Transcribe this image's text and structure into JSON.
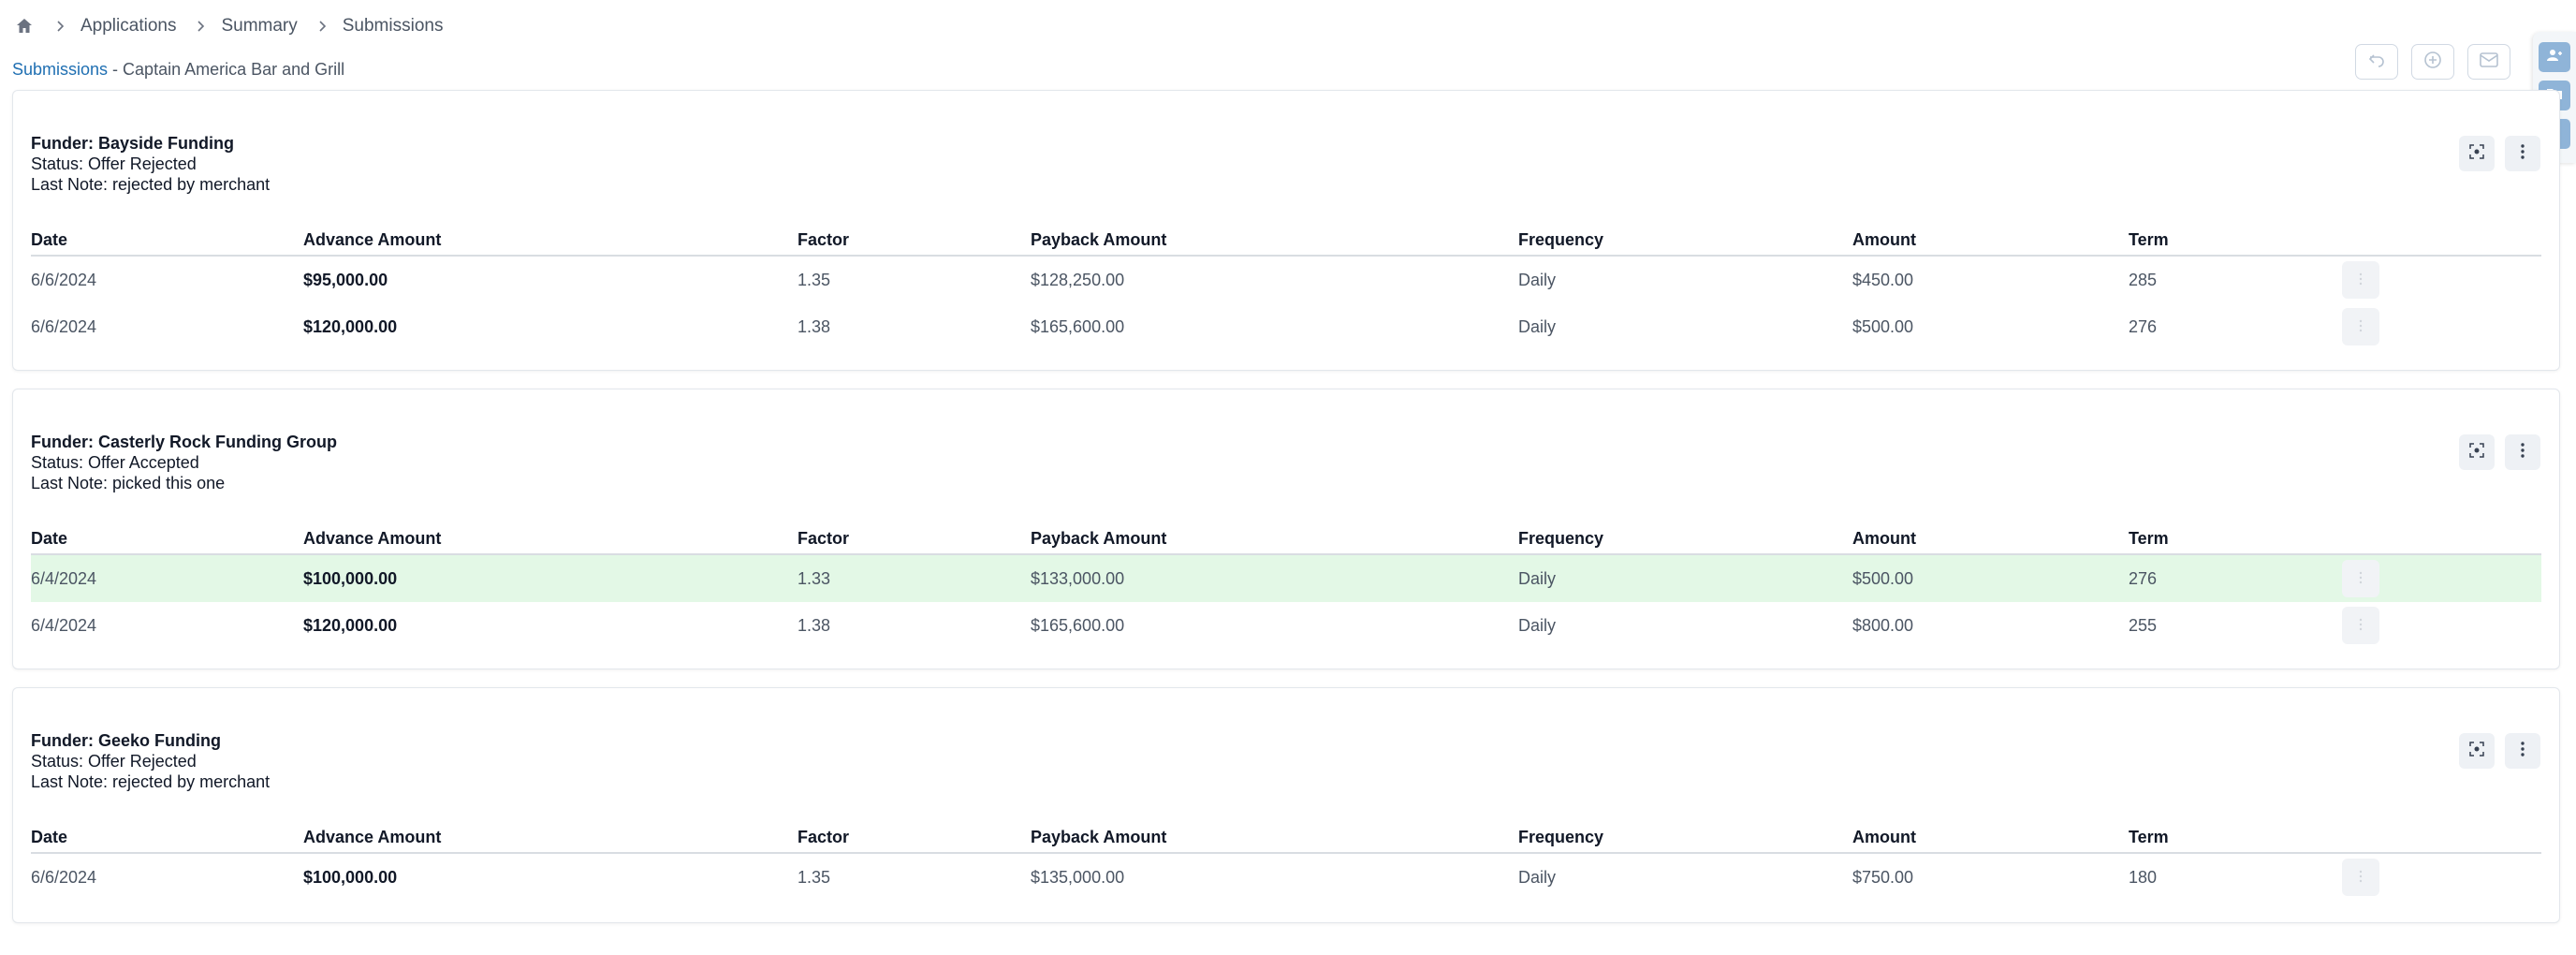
{
  "breadcrumb": {
    "home_icon": "home-icon",
    "items": [
      "Applications",
      "Summary",
      "Submissions"
    ]
  },
  "subheader": {
    "link": "Submissions",
    "separator": " - ",
    "business": "Captain America Bar and Grill"
  },
  "top_actions": [
    "undo-icon",
    "plus-circle-icon",
    "mail-icon"
  ],
  "side_rail": [
    "users-icon",
    "folder-icon",
    "bookmark-icon"
  ],
  "colors": {
    "link": "#1f6fb2",
    "accepted_row": "#e3f8e6",
    "rail_button": "#8fb4d8"
  },
  "columns": [
    "Date",
    "Advance Amount",
    "Factor",
    "Payback Amount",
    "Frequency",
    "Amount",
    "Term"
  ],
  "cards": [
    {
      "funder": "Funder: Bayside Funding",
      "status": "Status: Offer Rejected",
      "note": "Last Note: rejected by merchant",
      "rows": [
        {
          "date": "6/6/2024",
          "advance": "$95,000.00",
          "factor": "1.35",
          "payback": "$128,250.00",
          "frequency": "Daily",
          "amount": "$450.00",
          "term": "285"
        },
        {
          "date": "6/6/2024",
          "advance": "$120,000.00",
          "factor": "1.38",
          "payback": "$165,600.00",
          "frequency": "Daily",
          "amount": "$500.00",
          "term": "276"
        }
      ]
    },
    {
      "funder": "Funder: Casterly Rock Funding Group",
      "status": "Status: Offer Accepted",
      "note": "Last Note: picked this one",
      "rows": [
        {
          "date": "6/4/2024",
          "advance": "$100,000.00",
          "factor": "1.33",
          "payback": "$133,000.00",
          "frequency": "Daily",
          "amount": "$500.00",
          "term": "276",
          "accepted": true
        },
        {
          "date": "6/4/2024",
          "advance": "$120,000.00",
          "factor": "1.38",
          "payback": "$165,600.00",
          "frequency": "Daily",
          "amount": "$800.00",
          "term": "255"
        }
      ]
    },
    {
      "funder": "Funder: Geeko Funding",
      "status": "Status: Offer Rejected",
      "note": "Last Note: rejected by merchant",
      "rows": [
        {
          "date": "6/6/2024",
          "advance": "$100,000.00",
          "factor": "1.35",
          "payback": "$135,000.00",
          "frequency": "Daily",
          "amount": "$750.00",
          "term": "180"
        }
      ]
    }
  ]
}
